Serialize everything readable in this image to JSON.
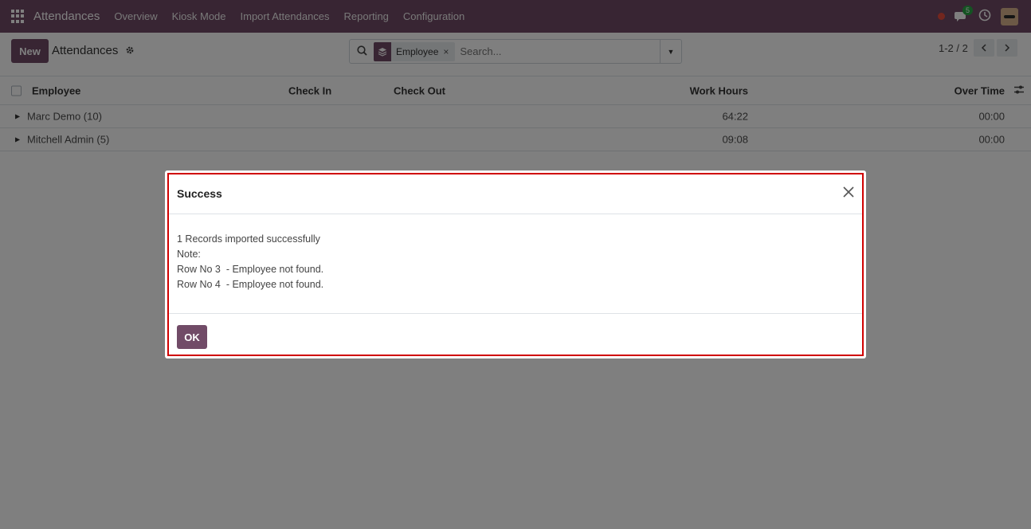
{
  "navbar": {
    "app_title": "Attendances",
    "menu": [
      "Overview",
      "Kiosk Mode",
      "Import Attendances",
      "Reporting",
      "Configuration"
    ],
    "chat_badge": "5",
    "icons": [
      "apps-grid-icon",
      "status-dot",
      "chat-icon",
      "clock-icon",
      "user-avatar"
    ]
  },
  "control_panel": {
    "new_label": "New",
    "breadcrumb": "Attendances",
    "search": {
      "facet_label": "Employee",
      "facet_close": "×",
      "placeholder": "Search..."
    },
    "pager": "1-2 / 2"
  },
  "list": {
    "columns": [
      "Employee",
      "Check In",
      "Check Out",
      "Work Hours",
      "Over Time"
    ],
    "groups": [
      {
        "label": "Marc Demo (10)",
        "work_hours": "64:22",
        "over_time": "00:00"
      },
      {
        "label": "Mitchell Admin (5)",
        "work_hours": "09:08",
        "over_time": "00:00"
      }
    ]
  },
  "dialog": {
    "title": "Success",
    "lines": [
      "1 Records imported successfully",
      "Note:",
      "Row No 3  - Employee not found.",
      "Row No 4  - Employee not found."
    ],
    "ok_label": "OK"
  },
  "colors": {
    "brand": "#714b67",
    "highlight_border": "#d00000",
    "badge_green": "#28a745"
  }
}
